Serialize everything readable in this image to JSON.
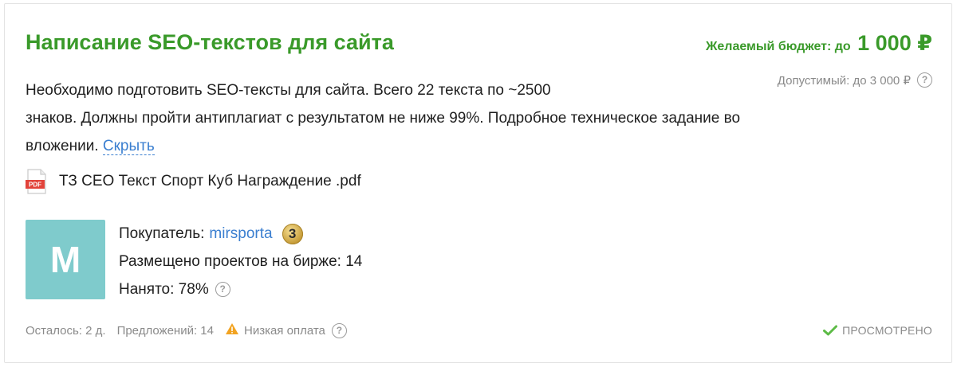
{
  "project": {
    "title": "Написание SEO-текстов для сайта",
    "budget_label": "Желаемый бюджет: до",
    "budget_amount": "1 000 ₽",
    "allowed_budget": "Допустимый: до 3 000 ₽",
    "description_line1": "Необходимо подготовить SEO-тексты для сайта. Всего 22 текста по ~2500",
    "description_line2": "знаков. Должны пройти антиплагиат с результатом не ниже 99%. Подробное техническое задание во",
    "description_line3": "вложении.",
    "hide_link": "Скрыть",
    "attachment_name": "ТЗ СЕО Текст Спорт Куб Награждение .pdf",
    "attachment_icon": "pdf-icon"
  },
  "buyer": {
    "avatar_letter": "M",
    "buyer_label": "Покупатель:",
    "buyer_name": "mirsporta",
    "level_badge": "3",
    "projects_text": "Размещено проектов на бирже: 14",
    "hired_text": "Нанято: 78%"
  },
  "footer": {
    "time_left": "Осталось: 2 д.",
    "offers": "Предложений: 14",
    "low_pay": "Низкая оплата",
    "status": "ПРОСМОТРЕНО"
  },
  "colors": {
    "accent_green": "#3a9a2a",
    "link_blue": "#3b7fd0",
    "avatar_bg": "#7fcbcc",
    "warning_orange": "#f2a321"
  }
}
